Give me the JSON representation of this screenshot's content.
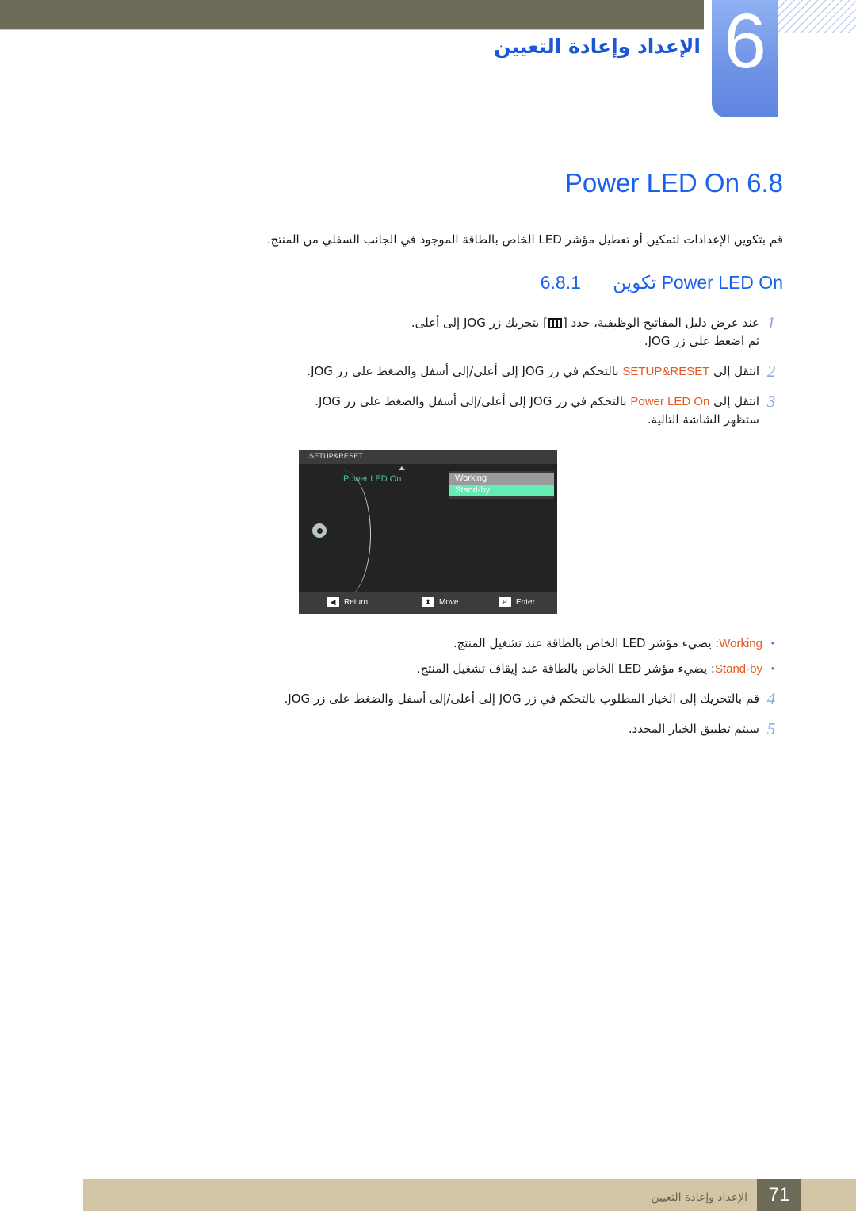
{
  "chapter": {
    "number": "6",
    "title": "الإعداد وإعادة التعيين"
  },
  "heading": {
    "h1": "Power LED On 6.8",
    "intro": "قم بتكوين الإعدادات لتمكين أو تعطيل مؤشر LED الخاص بالطاقة الموجود في الجانب السفلي من المنتج.",
    "h2_text": "Power LED On تكوين",
    "h2_number": "6.8.1"
  },
  "steps": [
    {
      "num": "1",
      "pre": "عند عرض دليل المفاتيح الوظيفية، حدد [",
      "icon": "menu-icon",
      "post": "] بتحريك زر JOG إلى أعلى.",
      "line2": "ثم اضغط على زر JOG."
    },
    {
      "num": "2",
      "pre": "انتقل إلى ",
      "keyword": "SETUP&RESET",
      "post": " بالتحكم في زر JOG إلى أعلى/إلى أسفل والضغط على زر JOG.",
      "line2": ""
    },
    {
      "num": "3",
      "pre": "انتقل إلى ",
      "keyword": "Power LED On",
      "post": " بالتحكم في زر JOG إلى أعلى/إلى أسفل والضغط على زر JOG.",
      "line2": "ستظهر الشاشة التالية."
    }
  ],
  "osd": {
    "title": "SETUP&RESET",
    "item_label": "Power LED On",
    "colon": ":",
    "options": [
      {
        "label": "Working",
        "state": "highlighted-gray"
      },
      {
        "label": "Stand-by",
        "state": "selected-green"
      }
    ],
    "footer_buttons": [
      {
        "key": "◀",
        "label": "Return"
      },
      {
        "key": "⬍",
        "label": "Move"
      },
      {
        "key": "↵",
        "label": "Enter"
      }
    ]
  },
  "bullets": [
    {
      "dot": "•",
      "keyword": "Working",
      "text": ": يضيء مؤشر LED الخاص بالطاقة عند تشغيل المنتج."
    },
    {
      "dot": "•",
      "keyword": "Stand-by",
      "text": ": يضيء مؤشر LED الخاص بالطاقة عند إيقاف تشغيل المنتج."
    }
  ],
  "steps2": [
    {
      "num": "4",
      "text": "قم بالتحريك إلى الخيار المطلوب بالتحكم في زر JOG إلى أعلى/إلى أسفل والضغط على زر JOG.",
      "line2": ""
    },
    {
      "num": "5",
      "text": "سيتم تطبيق الخيار المحدد.",
      "line2": ""
    }
  ],
  "footer": {
    "page": "71",
    "text": "الإعداد وإعادة التعيين"
  },
  "colors": {
    "band": "#6d6b57",
    "chapter_tab": "#6f93e6",
    "heading_blue": "#1a62ea",
    "keyword_orange": "#e2581e",
    "osd_green": "#49c79a",
    "osd_select_green": "#63ecb4",
    "footer_tan": "#d2c6a7"
  }
}
